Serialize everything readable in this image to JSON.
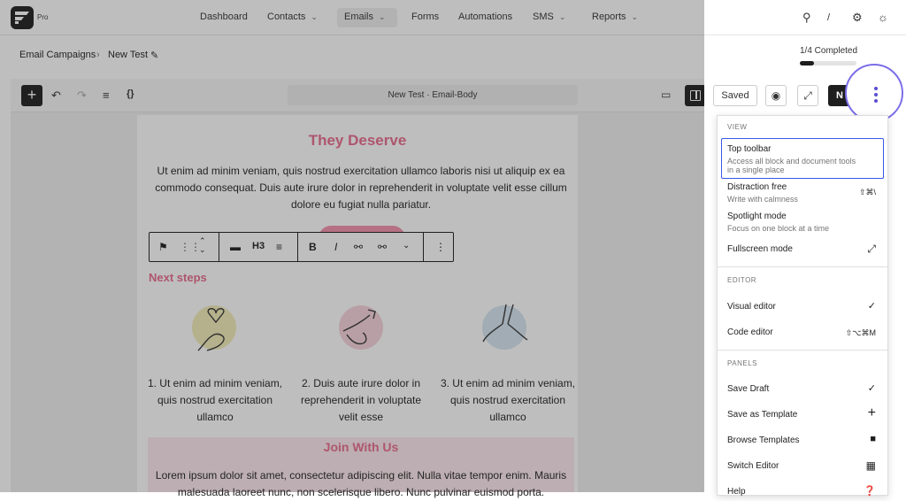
{
  "nav": {
    "brand_badge": "Pro",
    "items": [
      {
        "label": "Dashboard",
        "dropdown": false
      },
      {
        "label": "Contacts",
        "dropdown": true
      },
      {
        "label": "Emails",
        "dropdown": true,
        "active": true
      },
      {
        "label": "Forms",
        "dropdown": false
      },
      {
        "label": "Automations",
        "dropdown": false
      },
      {
        "label": "SMS",
        "dropdown": true
      },
      {
        "label": "Reports",
        "dropdown": true
      }
    ],
    "search_shortcut": "/"
  },
  "breadcrumb": {
    "parent": "Email Campaigns",
    "current": "New Test"
  },
  "editor": {
    "document_title": "New Test · Email-Body",
    "saved_label": "Saved",
    "publish_label": "N"
  },
  "onboarding": {
    "progress_text": "1/4 Completed",
    "progress_fraction": 0.25
  },
  "content": {
    "heading": "They Deserve",
    "paragraph1": "Ut enim ad minim veniam, quis nostrud exercitation ullamco laboris nisi ut aliquip ex ea commodo consequat. Duis aute irure dolor in reprehenderit in voluptate velit esse cillum dolore eu fugiat nulla pariatur.",
    "block_toolbar_heading_level": "H3",
    "next_steps": "Next steps",
    "steps": [
      "1. Ut enim ad minim veniam, quis nostrud exercitation ullamco",
      "2. Duis aute irure dolor in reprehenderit in voluptate velit esse",
      "3. Ut enim ad minim veniam, quis nostrud exercitation ullamco"
    ],
    "join_heading": "Join With Us",
    "paragraph2": "Lorem ipsum dolor sit amet, consectetur adipiscing elit. Nulla vitae tempor enim. Mauris malesuada laoreet nunc, non scelerisque libero. Nunc pulvinar euismod porta."
  },
  "menu": {
    "view_label": "VIEW",
    "top_toolbar": {
      "label": "Top toolbar",
      "desc": "Access all block and document tools in a single place"
    },
    "distraction_free": {
      "label": "Distraction free",
      "desc": "Write with calmness",
      "shortcut": "⇧⌘\\"
    },
    "spotlight": {
      "label": "Spotlight mode",
      "desc": "Focus on one block at a time"
    },
    "fullscreen": {
      "label": "Fullscreen mode"
    },
    "editor_label": "EDITOR",
    "visual_editor": {
      "label": "Visual editor",
      "check": "✓"
    },
    "code_editor": {
      "label": "Code editor",
      "shortcut": "⇧⌥⌘M"
    },
    "panels_label": "PANELS",
    "save_draft": {
      "label": "Save Draft",
      "check": "✓"
    },
    "save_template": {
      "label": "Save as Template"
    },
    "browse_templates": {
      "label": "Browse Templates"
    },
    "switch_editor": {
      "label": "Switch Editor"
    },
    "help": {
      "label": "Help"
    }
  },
  "colors": {
    "accent": "#e96a8d",
    "highlight": "#3858e9",
    "kebab_ring": "#7b6ee8"
  }
}
